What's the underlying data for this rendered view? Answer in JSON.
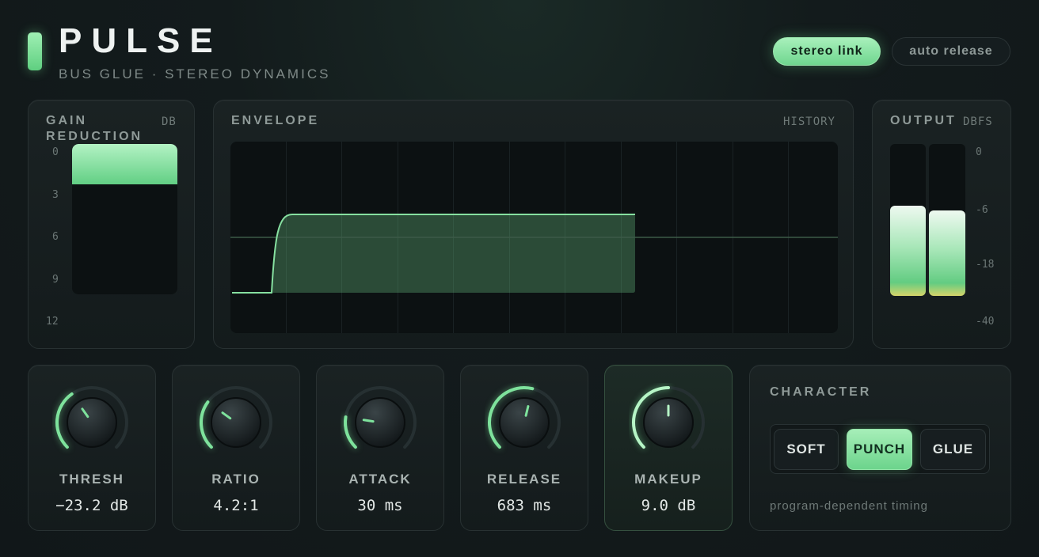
{
  "header": {
    "title": "PULSE",
    "subtitle": "BUS GLUE · STEREO DYNAMICS",
    "toggles": [
      {
        "label": "stereo link",
        "active": true
      },
      {
        "label": "auto release",
        "active": false
      }
    ]
  },
  "gain_reduction": {
    "title": "GAIN REDUCTION",
    "unit": "DB",
    "scale": [
      "0",
      "3",
      "6",
      "9",
      "12"
    ],
    "value_db": 3.2,
    "max_db": 12
  },
  "envelope": {
    "title": "ENVELOPE",
    "tag": "HISTORY"
  },
  "output": {
    "title": "OUTPUT",
    "unit": "DBFS",
    "scale": [
      "0",
      "-6",
      "-18",
      "-40"
    ],
    "left_level": 0.6,
    "right_level": 0.57
  },
  "knobs": [
    {
      "label": "THRESH",
      "value": "−23.2 dB",
      "fraction": 0.37
    },
    {
      "label": "RATIO",
      "value": "4.2:1",
      "fraction": 0.3
    },
    {
      "label": "ATTACK",
      "value": "30 ms",
      "fraction": 0.2
    },
    {
      "label": "RELEASE",
      "value": "683 ms",
      "fraction": 0.55
    },
    {
      "label": "MAKEUP",
      "value": "9.0 dB",
      "fraction": 0.5,
      "highlighted": true
    }
  ],
  "character": {
    "title": "CHARACTER",
    "options": [
      {
        "label": "SOFT",
        "active": false
      },
      {
        "label": "PUNCH",
        "active": true
      },
      {
        "label": "GLUE",
        "active": false
      }
    ],
    "note": "program-dependent timing"
  },
  "colors": {
    "accent": "#7ee29c",
    "accent_light": "#b6f5c6",
    "background": "#131b1c",
    "panel": "#181f20",
    "meter_yellow": "#d6d46a"
  }
}
